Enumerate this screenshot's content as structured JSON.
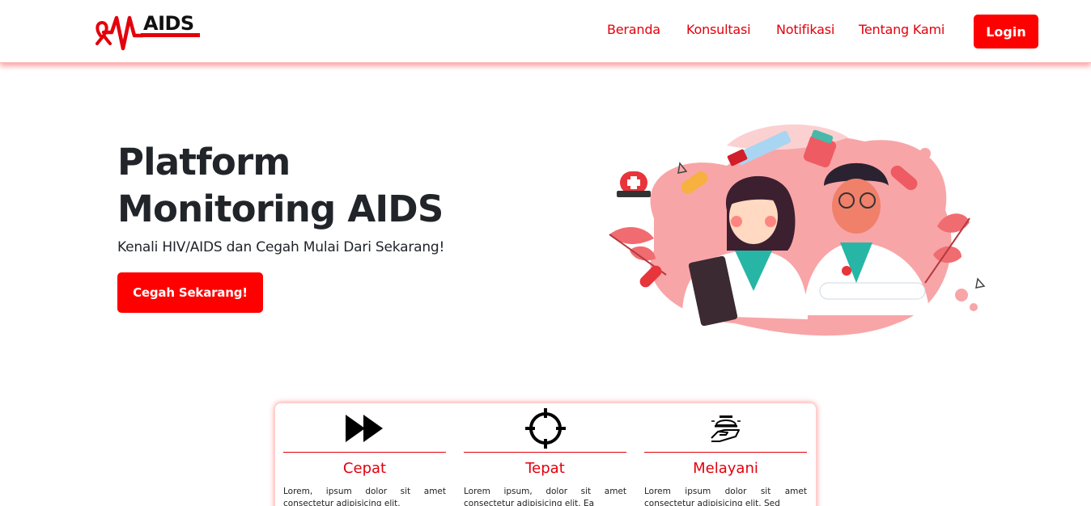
{
  "brand": {
    "name": "AIDS",
    "accent_color": "#e3000b",
    "logo_icon": "ribbon-heartbeat-icon"
  },
  "nav": {
    "items": [
      {
        "label": "Beranda"
      },
      {
        "label": "Konsultasi"
      },
      {
        "label": "Notifikasi"
      },
      {
        "label": "Tentang Kami"
      }
    ],
    "login_label": "Login"
  },
  "hero": {
    "title_line1": "Platform",
    "title_line2": "Monitoring AIDS",
    "subtitle": "Kenali HIV/AIDS dan Cegah Mulai Dari Sekarang!",
    "cta_label": "Cegah Sekarang!",
    "illustration": "doctors-illustration"
  },
  "features": [
    {
      "icon": "fast-forward-icon",
      "title": "Cepat",
      "desc": "Lorem, ipsum dolor sit amet consectetur adipisicing elit."
    },
    {
      "icon": "crosshair-icon",
      "title": "Tepat",
      "desc": "Lorem ipsum, dolor sit amet consectetur adipisicing elit. Ea"
    },
    {
      "icon": "serving-hand-icon",
      "title": "Melayani",
      "desc": "Lorem ipsum dolor sit amet consectetur adipisicing elit. Sed"
    }
  ]
}
